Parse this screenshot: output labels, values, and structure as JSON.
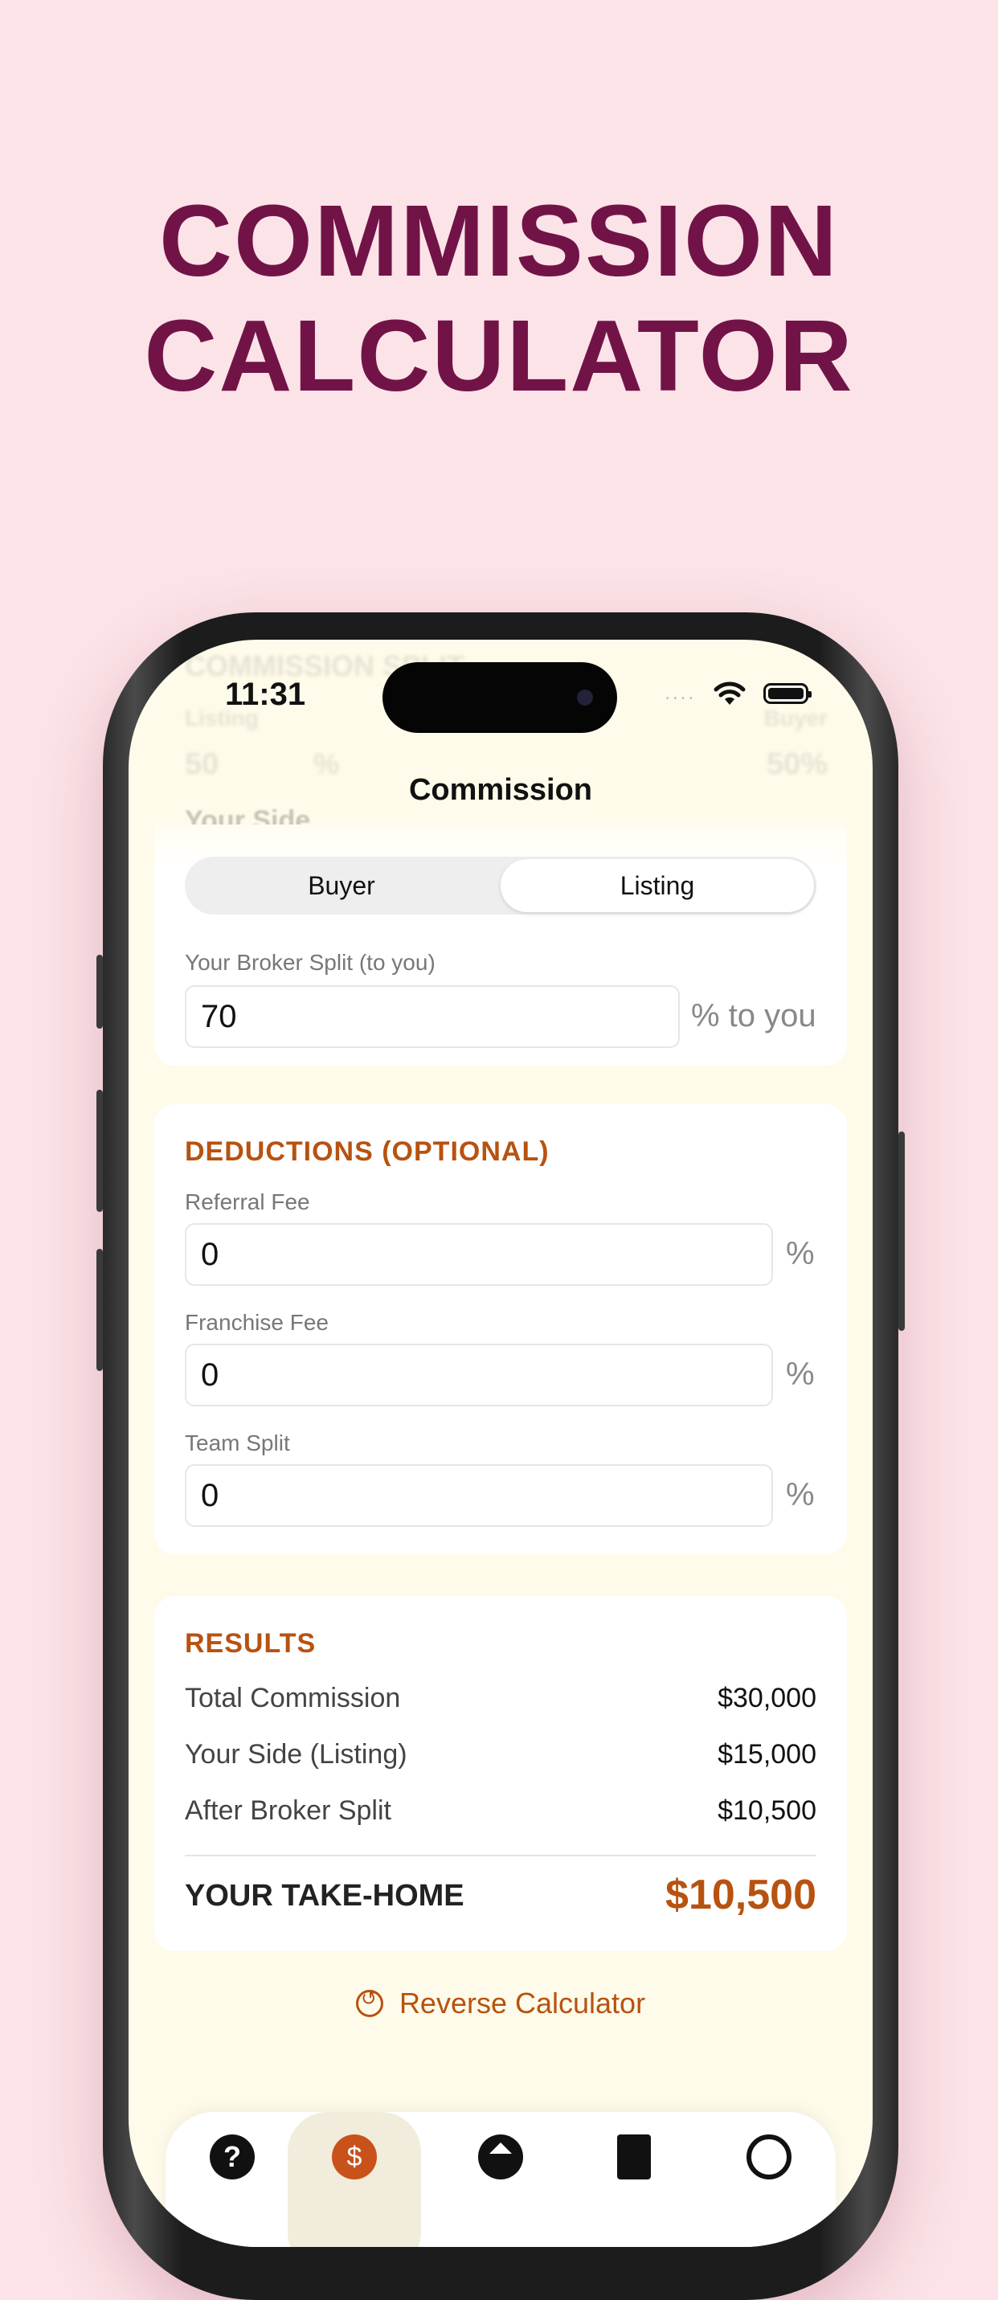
{
  "headline": {
    "line1": "COMMISSION",
    "line2": "CALCULATOR"
  },
  "status_bar": {
    "time": "11:31",
    "signal_dots": "....",
    "wifi_icon": "wifi-icon",
    "battery_icon": "battery-icon"
  },
  "ghost_header": {
    "section": "COMMISSION SPLIT",
    "left_label": "Listing",
    "right_label": "Buyer",
    "left_value": "50",
    "mid_unit": "%",
    "right_value": "50%"
  },
  "your_side_label": "Your Side",
  "nav": {
    "title": "Commission"
  },
  "side_selector": {
    "options": [
      "Buyer",
      "Listing"
    ],
    "selected": "Listing"
  },
  "broker_split": {
    "label": "Your Broker Split (to you)",
    "value": "70",
    "suffix": "% to you"
  },
  "deductions": {
    "title": "DEDUCTIONS (OPTIONAL)",
    "fields": [
      {
        "label": "Referral Fee",
        "value": "0",
        "suffix": "%"
      },
      {
        "label": "Franchise Fee",
        "value": "0",
        "suffix": "%"
      },
      {
        "label": "Team Split",
        "value": "0",
        "suffix": "%"
      }
    ]
  },
  "results": {
    "title": "RESULTS",
    "rows": [
      {
        "label": "Total Commission",
        "value": "$30,000"
      },
      {
        "label": "Your Side (Listing)",
        "value": "$15,000"
      },
      {
        "label": "After Broker Split",
        "value": "$10,500"
      }
    ],
    "take_home_label": "YOUR TAKE-HOME",
    "take_home_value": "$10,500"
  },
  "reverse_button": {
    "label": "Reverse Calculator",
    "icon": "undo-circle-icon"
  },
  "tab_bar": {
    "items": [
      {
        "icon": "help-icon",
        "glyph": "?"
      },
      {
        "icon": "dollar-icon",
        "glyph": "$"
      },
      {
        "icon": "home-icon",
        "glyph": ""
      },
      {
        "icon": "document-icon",
        "glyph": ""
      },
      {
        "icon": "gear-icon",
        "glyph": ""
      }
    ],
    "selected_index": 1
  },
  "colors": {
    "background": "#fbe3e7",
    "headline": "#721348",
    "accent": "#b8520f",
    "screen": "#fefbea"
  }
}
